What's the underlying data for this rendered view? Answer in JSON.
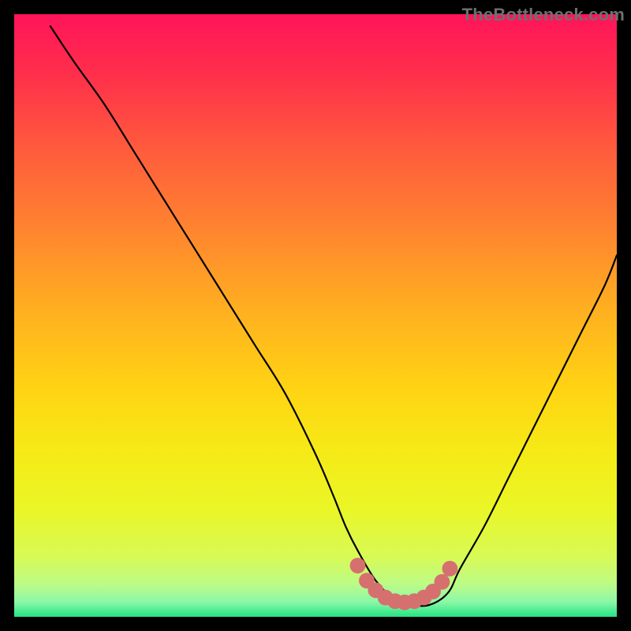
{
  "watermark": "TheBottleneck.com",
  "colors": {
    "gradient": [
      {
        "stop": 0.0,
        "color": "#ff145a"
      },
      {
        "stop": 0.1,
        "color": "#ff2f4b"
      },
      {
        "stop": 0.22,
        "color": "#ff5a3d"
      },
      {
        "stop": 0.35,
        "color": "#ff8230"
      },
      {
        "stop": 0.5,
        "color": "#ffb21f"
      },
      {
        "stop": 0.62,
        "color": "#ffd313"
      },
      {
        "stop": 0.72,
        "color": "#f6e916"
      },
      {
        "stop": 0.82,
        "color": "#eaf626"
      },
      {
        "stop": 0.9,
        "color": "#d8fa56"
      },
      {
        "stop": 0.945,
        "color": "#bdfb86"
      },
      {
        "stop": 0.975,
        "color": "#8cf8a7"
      },
      {
        "stop": 1.0,
        "color": "#23e585"
      }
    ],
    "line": "#000000",
    "marker": "#d6706e"
  },
  "chart_data": {
    "type": "line",
    "title": "",
    "xlabel": "",
    "ylabel": "",
    "xlim": [
      0,
      100
    ],
    "ylim": [
      0,
      100
    ],
    "grid": false,
    "legend_position": "none",
    "annotations": [
      {
        "text": "TheBottleneck.com",
        "position": "top-right"
      }
    ],
    "series": [
      {
        "name": "bottleneck-curve",
        "x": [
          6,
          10,
          15,
          20,
          25,
          30,
          35,
          40,
          45,
          50,
          53,
          55,
          57,
          60,
          63,
          66,
          69,
          72,
          74,
          78,
          82,
          86,
          90,
          94,
          98,
          100
        ],
        "y": [
          98,
          92,
          85,
          77,
          69,
          61,
          53,
          45,
          37,
          27,
          20,
          15,
          11,
          6,
          3,
          2,
          2,
          4,
          8,
          15,
          23,
          31,
          39,
          47,
          55,
          60
        ]
      }
    ],
    "markers": [
      {
        "name": "optimal-zone",
        "shape": "circle",
        "radius_pct": 1.3,
        "fill": "#d6706e",
        "x": [
          57.0,
          58.5,
          60.0,
          61.6,
          63.2,
          64.8,
          66.4,
          68.0,
          69.5,
          71.0,
          72.3
        ],
        "y": [
          8.5,
          6.0,
          4.4,
          3.2,
          2.6,
          2.4,
          2.6,
          3.2,
          4.2,
          5.8,
          8.0
        ]
      }
    ]
  }
}
